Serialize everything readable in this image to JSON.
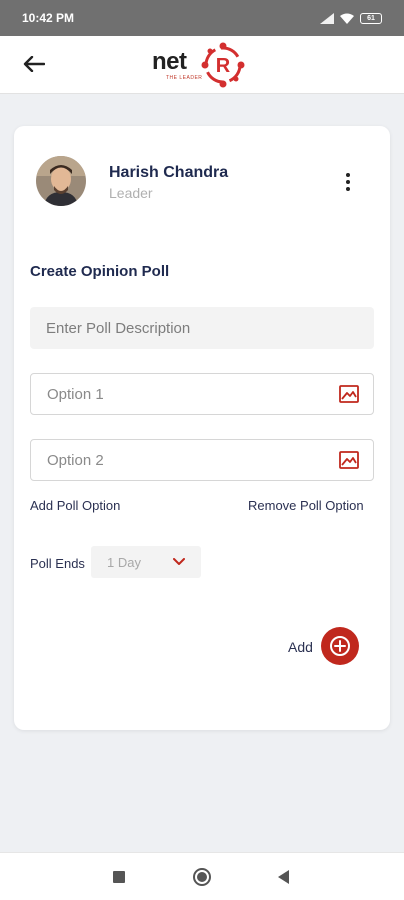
{
  "status_bar": {
    "time": "10:42 PM",
    "battery": "61"
  },
  "app_bar": {
    "logo_text": "net",
    "logo_mark": "R",
    "logo_tagline": "THE LEADER",
    "icons": {
      "back": "arrow-left-icon"
    }
  },
  "profile": {
    "name": "Harish Chandra",
    "role": "Leader",
    "icons": {
      "menu": "more-vertical-icon"
    }
  },
  "poll": {
    "title": "Create Opinion Poll",
    "description_placeholder": "Enter Poll Description",
    "options": [
      {
        "placeholder": "Option 1",
        "icon": "image-icon"
      },
      {
        "placeholder": "Option 2",
        "icon": "image-icon"
      }
    ],
    "add_option_label": "Add Poll Option",
    "remove_option_label": "Remove Poll Option",
    "ends_label": "Poll Ends",
    "ends_value": "1 Day",
    "add_label": "Add"
  },
  "colors": {
    "accent": "#c0281d",
    "heading": "#1f2a4f"
  }
}
